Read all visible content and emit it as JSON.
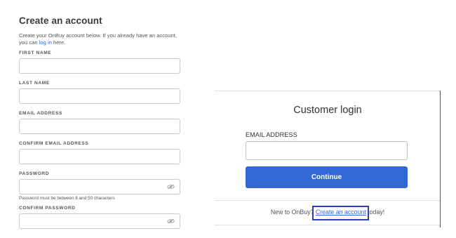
{
  "register": {
    "title": "Create an account",
    "intro_before": "Create your OnBuy account below. If you already have an account, you can ",
    "intro_link": "log in",
    "intro_after": " here.",
    "fields": {
      "first_name": {
        "label": "FIRST NAME",
        "value": ""
      },
      "last_name": {
        "label": "LAST NAME",
        "value": ""
      },
      "email": {
        "label": "EMAIL ADDRESS",
        "value": ""
      },
      "confirm_email": {
        "label": "CONFIRM EMAIL ADDRESS",
        "value": ""
      },
      "password": {
        "label": "PASSWORD",
        "value": "",
        "hint": "Password must be between 8 and 50 characters"
      },
      "confirm_password": {
        "label": "CONFIRM PASSWORD",
        "value": ""
      }
    }
  },
  "login": {
    "title": "Customer login",
    "email_label": "EMAIL ADDRESS",
    "email_value": "",
    "continue_label": "Continue",
    "footer_before": "New to OnBuy? ",
    "footer_link": "Create an account",
    "footer_after": " today!"
  },
  "colors": {
    "primary_button": "#3368d4",
    "link": "#2d6bd8",
    "highlight": "#2f3fb5"
  },
  "icons": {
    "password_toggle": "eye-off-icon"
  }
}
